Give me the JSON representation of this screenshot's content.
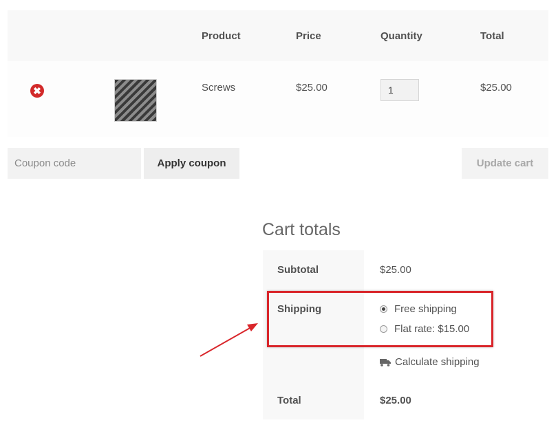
{
  "cart": {
    "headers": {
      "product": "Product",
      "price": "Price",
      "quantity": "Quantity",
      "total": "Total"
    },
    "items": [
      {
        "remove_glyph": "✖",
        "product_name": "Screws",
        "price": "$25.00",
        "quantity": "1",
        "total": "$25.00"
      }
    ]
  },
  "actions": {
    "coupon_placeholder": "Coupon code",
    "apply_coupon_label": "Apply coupon",
    "update_cart_label": "Update cart"
  },
  "totals": {
    "title": "Cart totals",
    "subtotal_label": "Subtotal",
    "subtotal_value": "$25.00",
    "shipping_label": "Shipping",
    "shipping_options": [
      {
        "label": "Free shipping",
        "selected": true
      },
      {
        "label": "Flat rate: $15.00",
        "selected": false
      }
    ],
    "calculate_shipping_label": "Calculate shipping",
    "total_label": "Total",
    "total_value": "$25.00"
  },
  "icons": {
    "remove": "remove-icon",
    "truck": "truck-icon"
  },
  "colors": {
    "remove_red": "#d22a2a",
    "annotation_red": "#d9262b",
    "header_bg": "#f8f8f8",
    "button_bg": "#eeeeee"
  }
}
